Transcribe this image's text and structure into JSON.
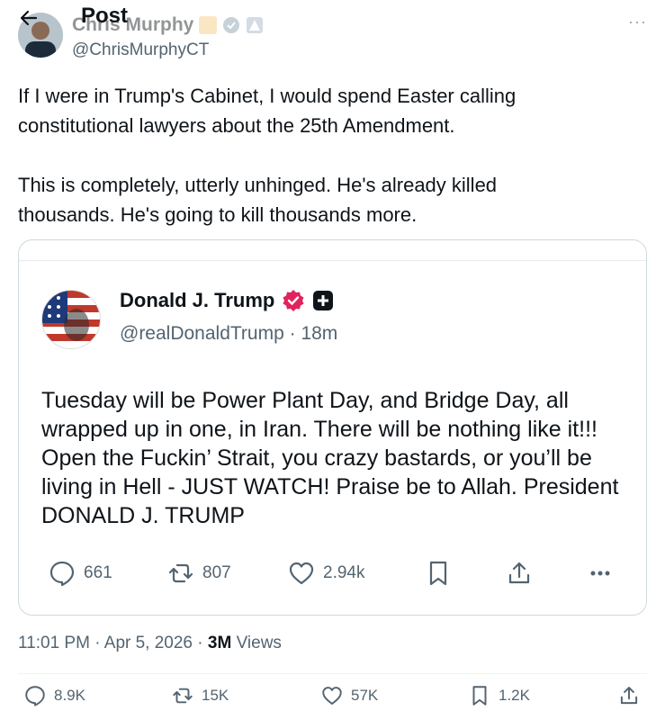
{
  "header": {
    "title": "Post"
  },
  "author": {
    "name": "Chris Murphy",
    "handle": "@ChrisMurphyCT",
    "more_label": "···"
  },
  "post": {
    "text": "If I were in Trump's Cabinet, I would spend Easter calling\nconstitutional lawyers about the 25th Amendment.\n\nThis is completely, utterly unhinged. He's already killed\nthousands. He's going to kill thousands more."
  },
  "quote": {
    "name": "Donald J. Trump",
    "handle": "@realDonaldTrump",
    "time": "18m",
    "text": "Tuesday will be Power Plant Day, and Bridge Day, all wrapped up in one, in Iran. There will be nothing like it!!! Open the Fuckin’ Strait, you crazy bastards, or you’ll be living in Hell - JUST WATCH! Praise be to Allah. President DONALD J. TRUMP",
    "actions": {
      "replies": "661",
      "reposts": "807",
      "likes": "2.94k"
    }
  },
  "meta": {
    "time": "11:01 PM",
    "date": "Apr 5, 2026",
    "views_count": "3M",
    "views_label": "Views"
  },
  "actions": {
    "replies": "8.9K",
    "reposts": "15K",
    "likes": "57K",
    "bookmarks": "1.2K"
  },
  "colors": {
    "text": "#0f1419",
    "muted": "#536471",
    "border": "#cfd9de",
    "verified_pink": "#e0245e"
  }
}
